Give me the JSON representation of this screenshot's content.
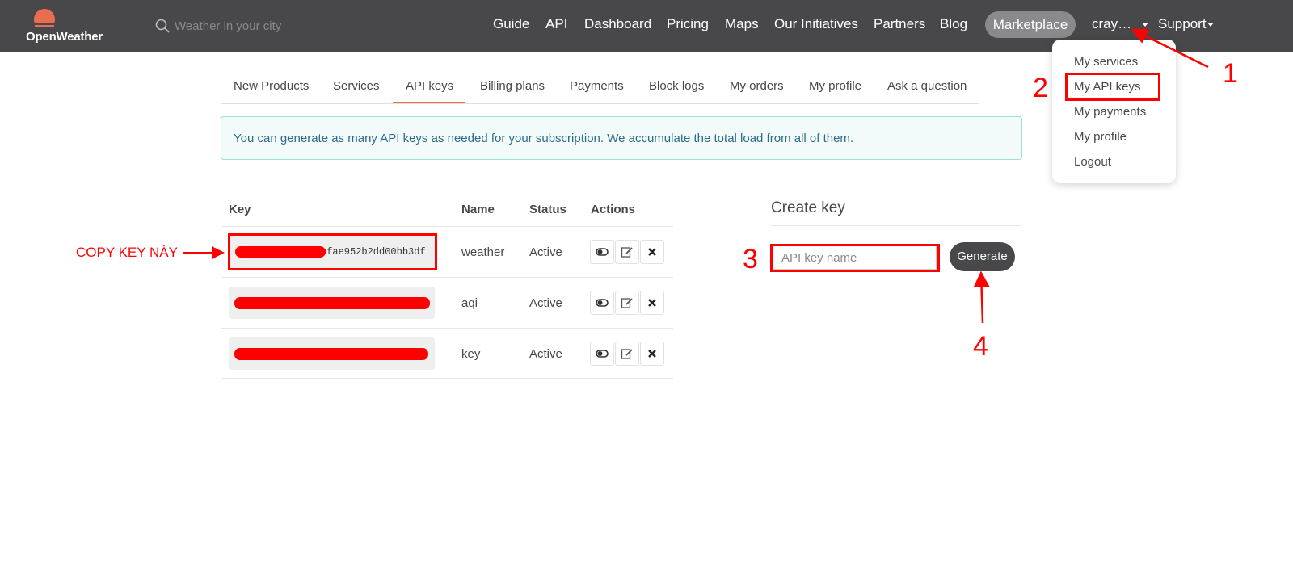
{
  "brand": {
    "logo_text": "OpenWeather",
    "accent": "#e96e50",
    "header_bg": "#48484a"
  },
  "search": {
    "placeholder": "Weather in your city"
  },
  "nav": {
    "guide": "Guide",
    "api": "API",
    "dashboard": "Dashboard",
    "pricing": "Pricing",
    "maps": "Maps",
    "initiatives": "Our Initiatives",
    "partners": "Partners",
    "blog": "Blog",
    "marketplace": "Marketplace",
    "user": "cray…",
    "support": "Support"
  },
  "user_menu": {
    "items": [
      "My services",
      "My API keys",
      "My payments",
      "My profile",
      "Logout"
    ]
  },
  "tabs": {
    "items": [
      "New Products",
      "Services",
      "API keys",
      "Billing plans",
      "Payments",
      "Block logs",
      "My orders",
      "My profile",
      "Ask a question"
    ],
    "active": "API keys"
  },
  "alert": {
    "text": "You can generate as many API keys as needed for your subscription. We accumulate the total load from all of them."
  },
  "keys_table": {
    "headers": {
      "key": "Key",
      "name": "Name",
      "status": "Status",
      "actions": "Actions"
    },
    "rows": [
      {
        "key_visible": "bfae952b2dd00bb3df",
        "name": "weather",
        "status": "Active"
      },
      {
        "key_visible": "",
        "name": "aqi",
        "status": "Active"
      },
      {
        "key_visible": "",
        "name": "key",
        "status": "Active"
      }
    ],
    "action_icons": [
      "toggle-icon",
      "edit-icon",
      "delete-icon"
    ]
  },
  "create_key": {
    "title": "Create key",
    "placeholder": "API key name",
    "button": "Generate"
  },
  "annotations": {
    "copy_label": "COPY KEY NÀY",
    "step1": "1",
    "step2": "2",
    "step3": "3",
    "step4": "4",
    "color": "#ff0000"
  }
}
